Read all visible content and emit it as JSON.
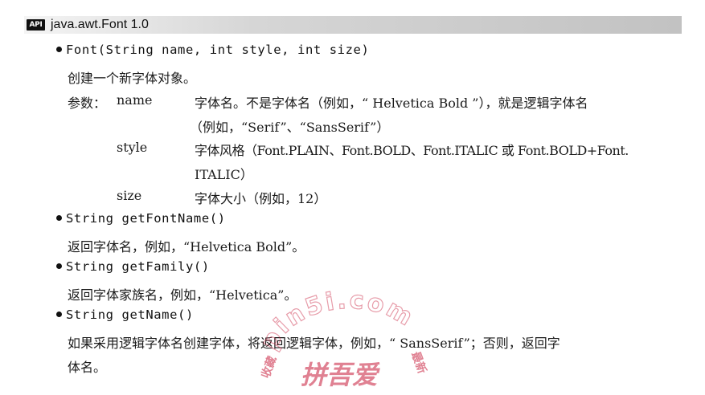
{
  "header": {
    "badge": "API",
    "title": "java.awt.Font 1.0"
  },
  "entries": [
    {
      "signature": "Font(String name, int style, int size)",
      "description": "创建一个新字体对象。",
      "params_label": "参数：",
      "params": [
        {
          "name": "name",
          "desc_lines": [
            "字体名。不是字体名（例如，“ Helvetica Bold ”），就是逻辑字体名",
            "（例如，“Serif”、“SansSerif”）"
          ]
        },
        {
          "name": "style",
          "desc_lines": [
            "字体风格（Font.PLAIN、Font.BOLD、Font.ITALIC 或 Font.BOLD+Font.",
            "ITALIC）"
          ]
        },
        {
          "name": "size",
          "desc_lines": [
            "字体大小（例如，12）"
          ]
        }
      ]
    },
    {
      "signature": "String getFontName()",
      "description": "返回字体名，例如，“Helvetica Bold”。"
    },
    {
      "signature": "String getFamily()",
      "description": "返回字体家族名，例如，“Helvetica”。"
    },
    {
      "signature": "String getName()",
      "description_lines": [
        "如果采用逻辑字体名创建字体，将返回逻辑字体，例如，“ SansSerif”；否则，返回字",
        "体名。"
      ]
    }
  ],
  "watermark": {
    "latin": "pin5i.com",
    "cjk_main": "拼吾爱",
    "cjk_left": "收藏",
    "cjk_right": "最新",
    "color": "#c81e3c"
  }
}
